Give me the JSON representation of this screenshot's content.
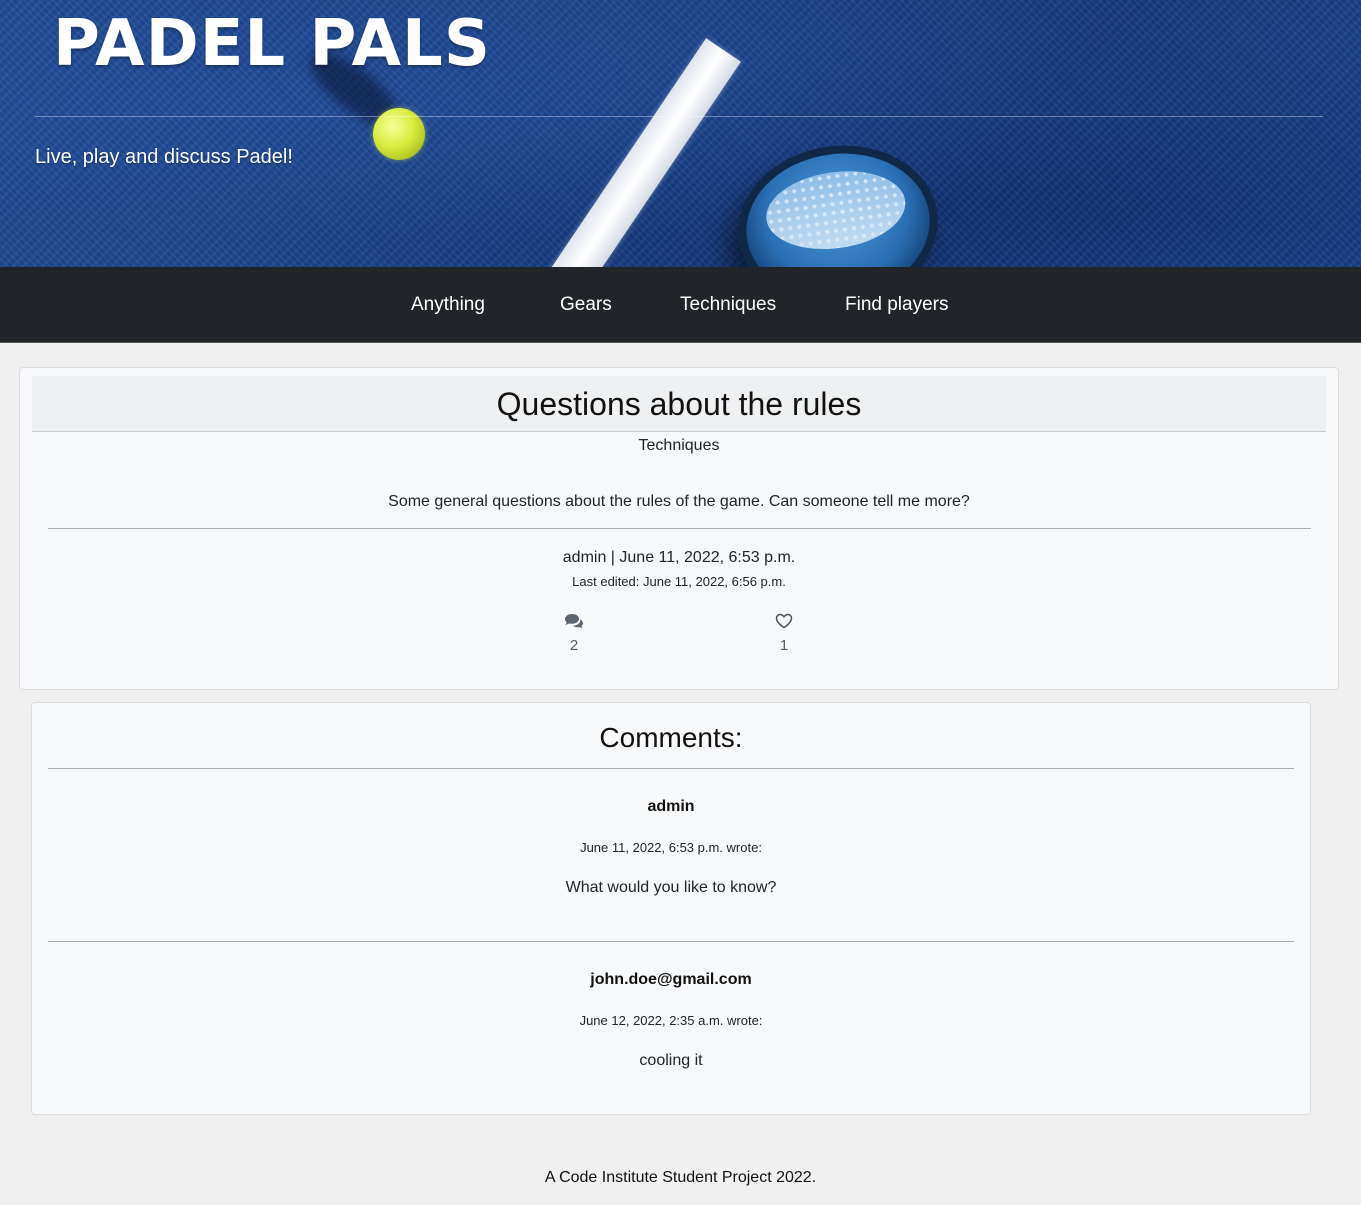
{
  "hero": {
    "title": "PADEL PALS",
    "subtitle": "Live, play and discuss Padel!"
  },
  "nav": {
    "items": [
      {
        "label": "Anything"
      },
      {
        "label": "Gears"
      },
      {
        "label": "Techniques"
      },
      {
        "label": "Find players"
      }
    ]
  },
  "post": {
    "title": "Questions about the rules",
    "category": "Techniques",
    "body": "Some general questions about the rules of the game. Can someone tell me more?",
    "meta": "admin | June 11, 2022, 6:53 p.m.",
    "edited": "Last edited: June 11, 2022, 6:56 p.m.",
    "comment_count": "2",
    "like_count": "1",
    "comment_icon": "comments-icon",
    "like_icon": "heart-outline-icon"
  },
  "comments": {
    "title": "Comments:",
    "items": [
      {
        "author": "admin",
        "date": "June 11, 2022, 6:53 p.m. wrote:",
        "text": "What would you like to know?"
      },
      {
        "author": "john.doe@gmail.com",
        "date": "June 12, 2022, 2:35 a.m. wrote:",
        "text": "cooling it"
      }
    ]
  },
  "footer": {
    "text": "A Code Institute Student Project 2022."
  },
  "colors": {
    "nav_bg": "#212529",
    "hero_blue": "#1b438a",
    "card_bg": "#f7f8fa",
    "page_bg": "#f0f0f0"
  }
}
